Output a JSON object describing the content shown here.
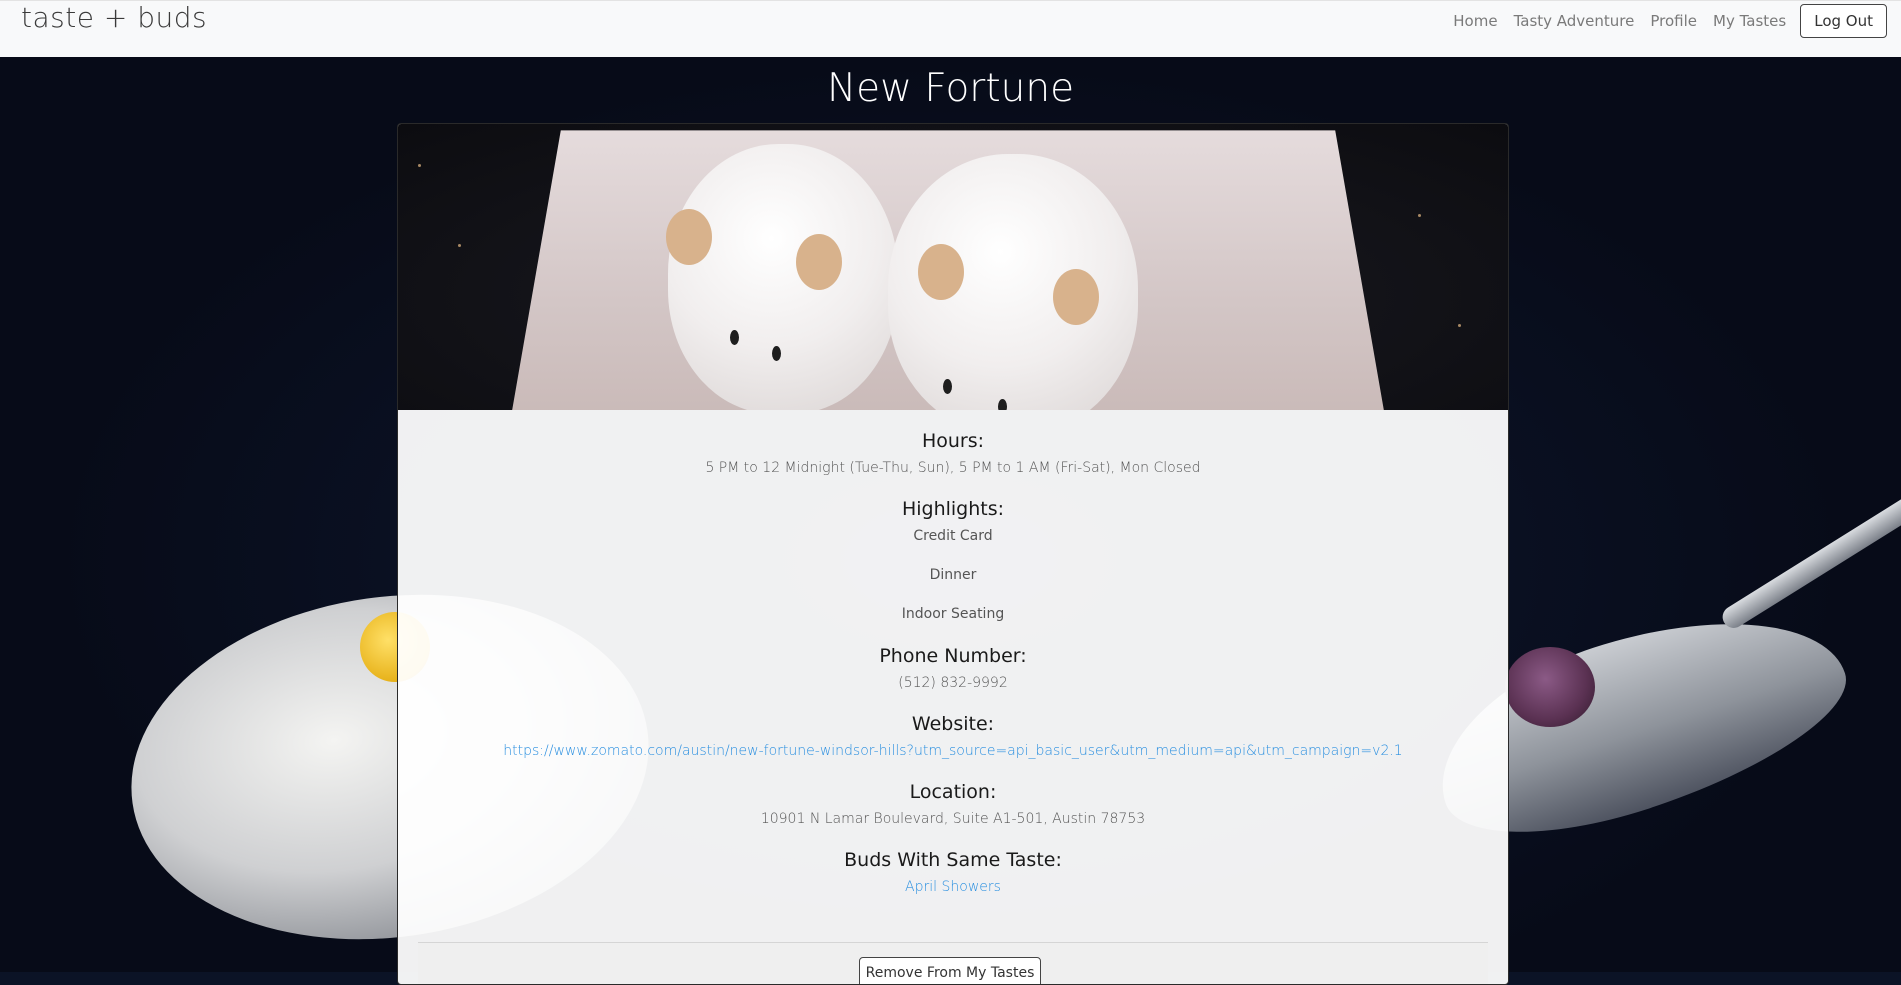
{
  "navbar": {
    "brand": "taste + buds",
    "links": [
      "Home",
      "Tasty Adventure",
      "Profile",
      "My Tastes"
    ],
    "logout_label": "Log Out"
  },
  "restaurant": {
    "name": "New Fortune",
    "hours_title": "Hours:",
    "hours": "5 PM to 12 Midnight (Tue-Thu, Sun), 5 PM to 1 AM (Fri-Sat), Mon Closed",
    "highlights_title": "Highlights:",
    "highlights": [
      "Credit Card",
      "Dinner",
      "Indoor Seating"
    ],
    "phone_title": "Phone Number:",
    "phone": "(512) 832-9992",
    "website_title": "Website:",
    "website": "https://www.zomato.com/austin/new-fortune-windsor-hills?utm_source=api_basic_user&utm_medium=api&utm_campaign=v2.1",
    "location_title": "Location:",
    "location": "10901 N Lamar Boulevard, Suite A1-501, Austin 78753",
    "buds_title": "Buds With Same Taste:",
    "buds": [
      "April Showers"
    ],
    "remove_label": "Remove From My Tastes"
  },
  "colors": {
    "link": "#2a8fe0",
    "navbar_bg": "#f8f9fa",
    "page_bg": "#0b1326"
  }
}
